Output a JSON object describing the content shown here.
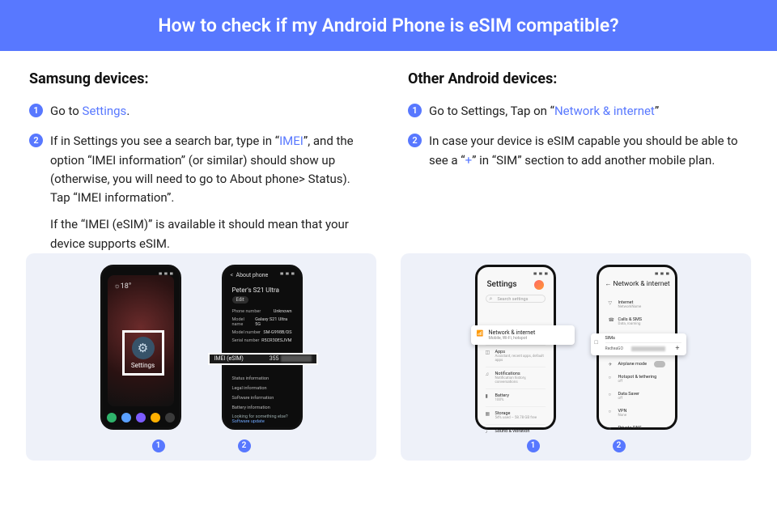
{
  "header": "How to check if my Android Phone is eSIM compatible?",
  "samsung": {
    "heading": "Samsung devices:",
    "step1_pre": "Go to ",
    "step1_link": "Settings",
    "step1_post": ".",
    "step2_pre": "If in Settings you see a search bar, type in “",
    "step2_link": "IMEI",
    "step2_post": "”, and the option “IMEI information” (or similar) should show up (otherwise, you will need to go to About phone> Status). Tap “IMEI information”.",
    "step2_extra": "If the “IMEI (eSIM)” is available it should mean that your device supports eSIM.",
    "shot1": {
      "temp": "☼18°",
      "settings_label": "Settings",
      "dock": [
        "#2fb36b",
        "#5aa0ff",
        "#7c5cff",
        "#ffb000",
        "#3a3a3a"
      ]
    },
    "shot2": {
      "back_title": "About phone",
      "device_name": "Peter's S21 Ultra",
      "edit": "Edit",
      "rows": [
        {
          "k": "Phone number",
          "v": "Unknown"
        },
        {
          "k": "Model name",
          "v": "Galaxy S21 Ultra 5G"
        },
        {
          "k": "Model number",
          "v": "SM-G998B/DS"
        },
        {
          "k": "Serial number",
          "v": "R5CR30ESJVM"
        }
      ],
      "callout_label": "IMEI (eSIM)",
      "callout_value_prefix": "355",
      "links": [
        "Status information",
        "Legal information",
        "Software information",
        "Battery information"
      ],
      "footer_q": "Looking for something else?",
      "footer_link": "Software update"
    },
    "labels": [
      "1",
      "2"
    ]
  },
  "other": {
    "heading": "Other Android devices:",
    "step1_pre": "Go to Settings, Tap on “",
    "step1_link": "Network & internet",
    "step1_post": "”",
    "step2_pre": "In case your device is eSIM capable you should be able to see a “",
    "step2_link": "+",
    "step2_post": "” in “SIM” section to add another mobile plan.",
    "shot1": {
      "title": "Settings",
      "search_placeholder": "Search settings",
      "callout_title": "Network & internet",
      "callout_sub": "Mobile, Wi-Fi, hotspot",
      "items": [
        {
          "ico": "◫",
          "t": "Apps",
          "s": "Assistant, recent apps, default apps"
        },
        {
          "ico": "♫",
          "t": "Notifications",
          "s": "Notification history, conversations"
        },
        {
          "ico": "▮",
          "t": "Battery",
          "s": "100%"
        },
        {
          "ico": "▦",
          "t": "Storage",
          "s": "54% used – 58.78 GB free"
        },
        {
          "ico": "♪",
          "t": "Sound & vibration",
          "s": ""
        }
      ]
    },
    "shot2": {
      "title": "Network & internet",
      "items_top": [
        {
          "ico": "▽",
          "t": "Internet",
          "s": "NetworkName"
        },
        {
          "ico": "☎",
          "t": "Calls & SMS",
          "s": "Data, roaming"
        }
      ],
      "callout_top": "SIMs",
      "callout_tag": "RedteaGO",
      "callout_plus": "+",
      "items_bottom": [
        {
          "ico": "✈",
          "t": "Airplane mode",
          "s": "",
          "toggle": true
        },
        {
          "ico": "○",
          "t": "Hotspot & tethering",
          "s": "off"
        },
        {
          "ico": "○",
          "t": "Data Saver",
          "s": "off"
        },
        {
          "ico": "○",
          "t": "VPN",
          "s": "None"
        },
        {
          "ico": "○",
          "t": "Private DNS",
          "s": ""
        }
      ]
    },
    "labels": [
      "1",
      "2"
    ]
  }
}
